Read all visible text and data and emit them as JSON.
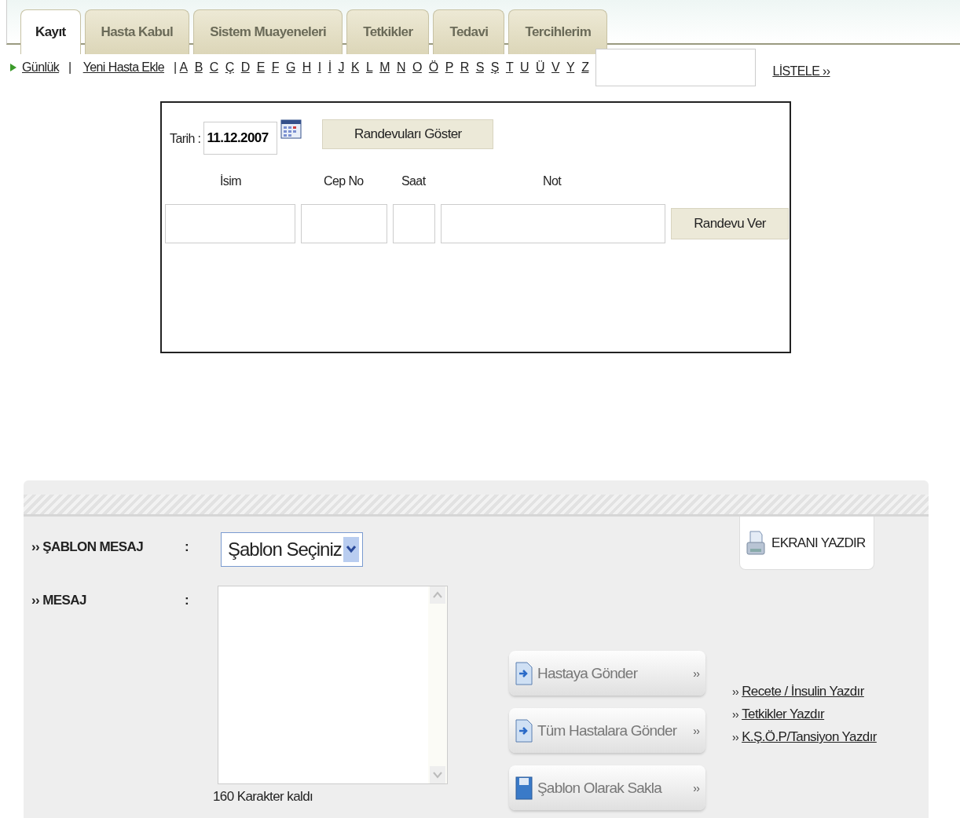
{
  "tabs": [
    {
      "label": "Kayıt",
      "selected": true
    },
    {
      "label": "Hasta Kabul",
      "selected": false
    },
    {
      "label": "Sistem Muayeneleri",
      "selected": false
    },
    {
      "label": "Tetkikler",
      "selected": false
    },
    {
      "label": "Tedavi",
      "selected": false
    },
    {
      "label": "Tercihlerim",
      "selected": false
    }
  ],
  "nav": {
    "daily": "Günlük",
    "separator": "|",
    "new_patient": "Yeni Hasta Ekle",
    "letters_separator": "|",
    "letters": [
      "A",
      "B",
      "C",
      "Ç",
      "D",
      "E",
      "F",
      "G",
      "H",
      "I",
      "İ",
      "J",
      "K",
      "L",
      "M",
      "N",
      "O",
      "Ö",
      "P",
      "R",
      "S",
      "Ş",
      "T",
      "U",
      "Ü",
      "V",
      "Y",
      "Z"
    ],
    "list_link": "LİSTELE ››"
  },
  "appointment": {
    "date_label": "Tarih :",
    "date_value": "11.12.2007",
    "show_button": "Randevuları Göster",
    "columns": [
      "İsim",
      "Cep No",
      "Saat",
      "Not"
    ],
    "give_button": "Randevu Ver"
  },
  "message_panel": {
    "template_label": "›› ŞABLON MESAJ",
    "colon_1": ":",
    "template_select": "Şablon Seçiniz",
    "message_label": "›› MESAJ",
    "colon_2": ":",
    "counter": "160 Karakter kaldı",
    "print_screen": "EKRANI YAZDIR",
    "actions": [
      {
        "kind": "send",
        "label": "Hastaya Gönder",
        "arrow": "››"
      },
      {
        "kind": "send",
        "label": "Tüm Hastalara Gönder",
        "arrow": "››"
      },
      {
        "kind": "save",
        "label": "Şablon Olarak Sakla",
        "arrow": "››"
      }
    ],
    "print_links": [
      {
        "marker": "››",
        "label": "Recete / İnsulin Yazdır"
      },
      {
        "marker": "››",
        "label": "Tetkikler Yazdır"
      },
      {
        "marker": "››",
        "label": "K.Ş.Ö.P/Tansiyon Yazdır"
      }
    ]
  }
}
